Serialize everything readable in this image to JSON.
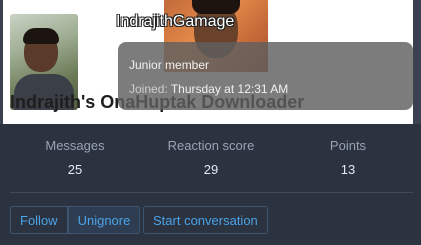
{
  "profile": {
    "username": "IndrajithGamage",
    "title": "Indrajith's OnaHuptak Downloader"
  },
  "tooltip": {
    "role": "Junior member",
    "joined_label": "Joined:",
    "joined_value": "Thursday at 12:31 AM"
  },
  "stats": [
    {
      "label": "Messages",
      "value": "25"
    },
    {
      "label": "Reaction score",
      "value": "29"
    },
    {
      "label": "Points",
      "value": "13"
    }
  ],
  "actions": {
    "follow": "Follow",
    "unignore": "Unignore",
    "start_conversation": "Start conversation"
  }
}
